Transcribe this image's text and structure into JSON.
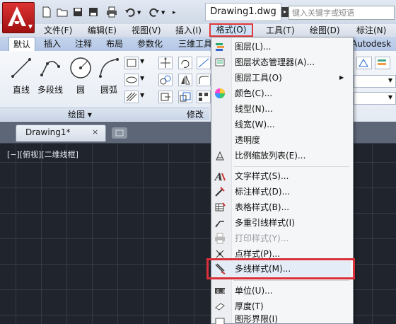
{
  "title_bar": {
    "document_title": "Drawing1.dwg",
    "search_placeholder": "键入关键字或短语"
  },
  "menu_bar": {
    "items": [
      "文件(F)",
      "编辑(E)",
      "视图(V)",
      "插入(I)",
      "格式(O)",
      "工具(T)",
      "绘图(D)",
      "标注(N)"
    ],
    "active": "格式(O)"
  },
  "ribbon": {
    "tabs": [
      "默认",
      "插入",
      "注释",
      "布局",
      "参数化",
      "三维工具"
    ],
    "partial_tab": "Autodesk 3",
    "draw_tools": [
      "直线",
      "多段线",
      "圆",
      "圆弧"
    ],
    "panel_draw_title": "绘图 ▾",
    "panel_modify_title": "修改 ▾"
  },
  "document_tab": {
    "label": "Drawing1*",
    "close": "×"
  },
  "canvas": {
    "viewport_label": "[−][俯视][二维线框]"
  },
  "format_menu": {
    "items": [
      {
        "label": "图层(L)...",
        "icon": "layer-icon"
      },
      {
        "label": "图层状态管理器(A)...",
        "icon": "layer-state-icon"
      },
      {
        "label": "图层工具(O)",
        "icon": "none",
        "submenu": true
      },
      {
        "label": "颜色(C)...",
        "icon": "color-wheel-icon"
      },
      {
        "label": "线型(N)...",
        "icon": "none"
      },
      {
        "label": "线宽(W)...",
        "icon": "none"
      },
      {
        "label": "透明度",
        "icon": "none"
      },
      {
        "label": "比例缩放列表(E)...",
        "icon": "scale-list-icon"
      },
      {
        "label": "文字样式(S)...",
        "icon": "text-style-icon"
      },
      {
        "label": "标注样式(D)...",
        "icon": "dim-style-icon"
      },
      {
        "label": "表格样式(B)...",
        "icon": "table-style-icon"
      },
      {
        "label": "多重引线样式(I)",
        "icon": "mleader-style-icon"
      },
      {
        "label": "打印样式(Y)...",
        "icon": "plot-style-icon",
        "disabled": true
      },
      {
        "label": "点样式(P)...",
        "icon": "point-style-icon"
      },
      {
        "label": "多线样式(M)...",
        "icon": "multiline-style-icon",
        "highlighted": true
      },
      {
        "label": "单位(U)...",
        "icon": "units-icon"
      },
      {
        "label": "厚度(T)",
        "icon": "thickness-icon"
      },
      {
        "label": "图形界限(I)",
        "icon": "limits-icon"
      }
    ]
  },
  "colors": {
    "highlight_border": "#d8303a",
    "canvas_bg": "#20242d",
    "menu_bg": "#f5f6f7"
  }
}
